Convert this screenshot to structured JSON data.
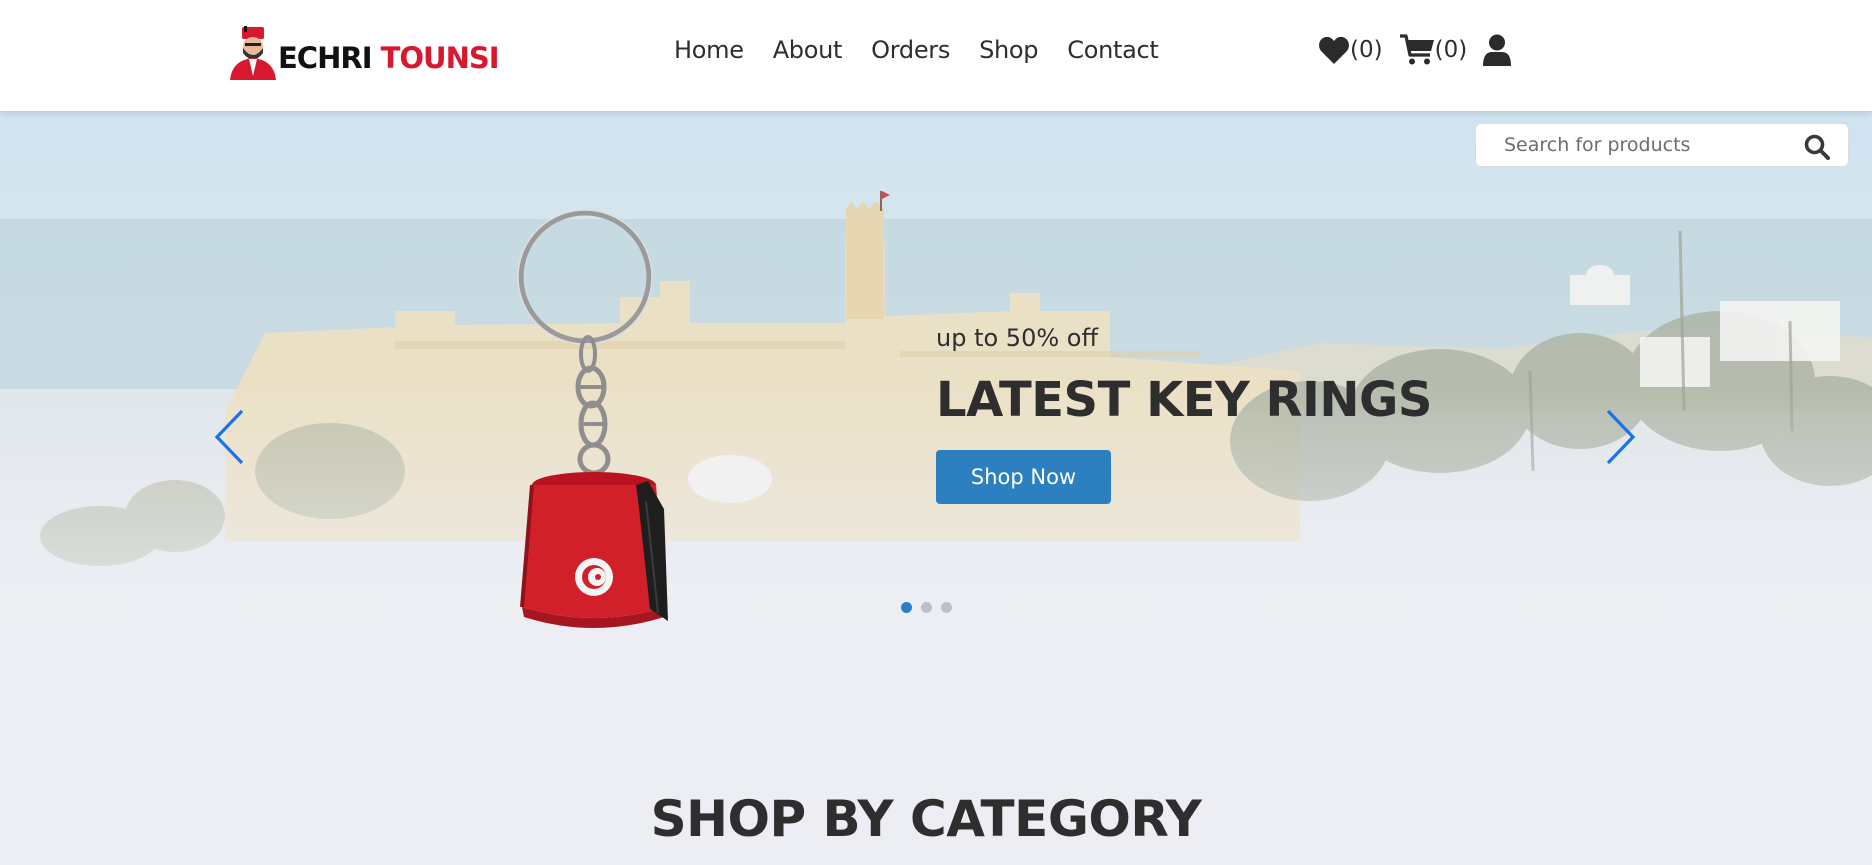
{
  "brand": {
    "name_part1": "ECHRI",
    "name_part2": "TOUNSI",
    "primary_color": "#d8182f"
  },
  "nav": {
    "items": [
      {
        "label": "Home"
      },
      {
        "label": "About"
      },
      {
        "label": "Orders"
      },
      {
        "label": "Shop"
      },
      {
        "label": "Contact"
      }
    ]
  },
  "header_icons": {
    "wishlist": {
      "icon": "heart-icon",
      "count": "(0)"
    },
    "cart": {
      "icon": "cart-icon",
      "count": "(0)"
    },
    "account": {
      "icon": "user-icon"
    }
  },
  "search": {
    "placeholder": "Search for products",
    "value": ""
  },
  "hero": {
    "subtitle": "up to 50% off",
    "title": "LATEST KEY RINGS",
    "cta_label": "Shop Now",
    "accent_color": "#2d80bf",
    "slides_total": 3,
    "active_slide": 1
  },
  "section": {
    "title": "SHOP BY CATEGORY"
  }
}
